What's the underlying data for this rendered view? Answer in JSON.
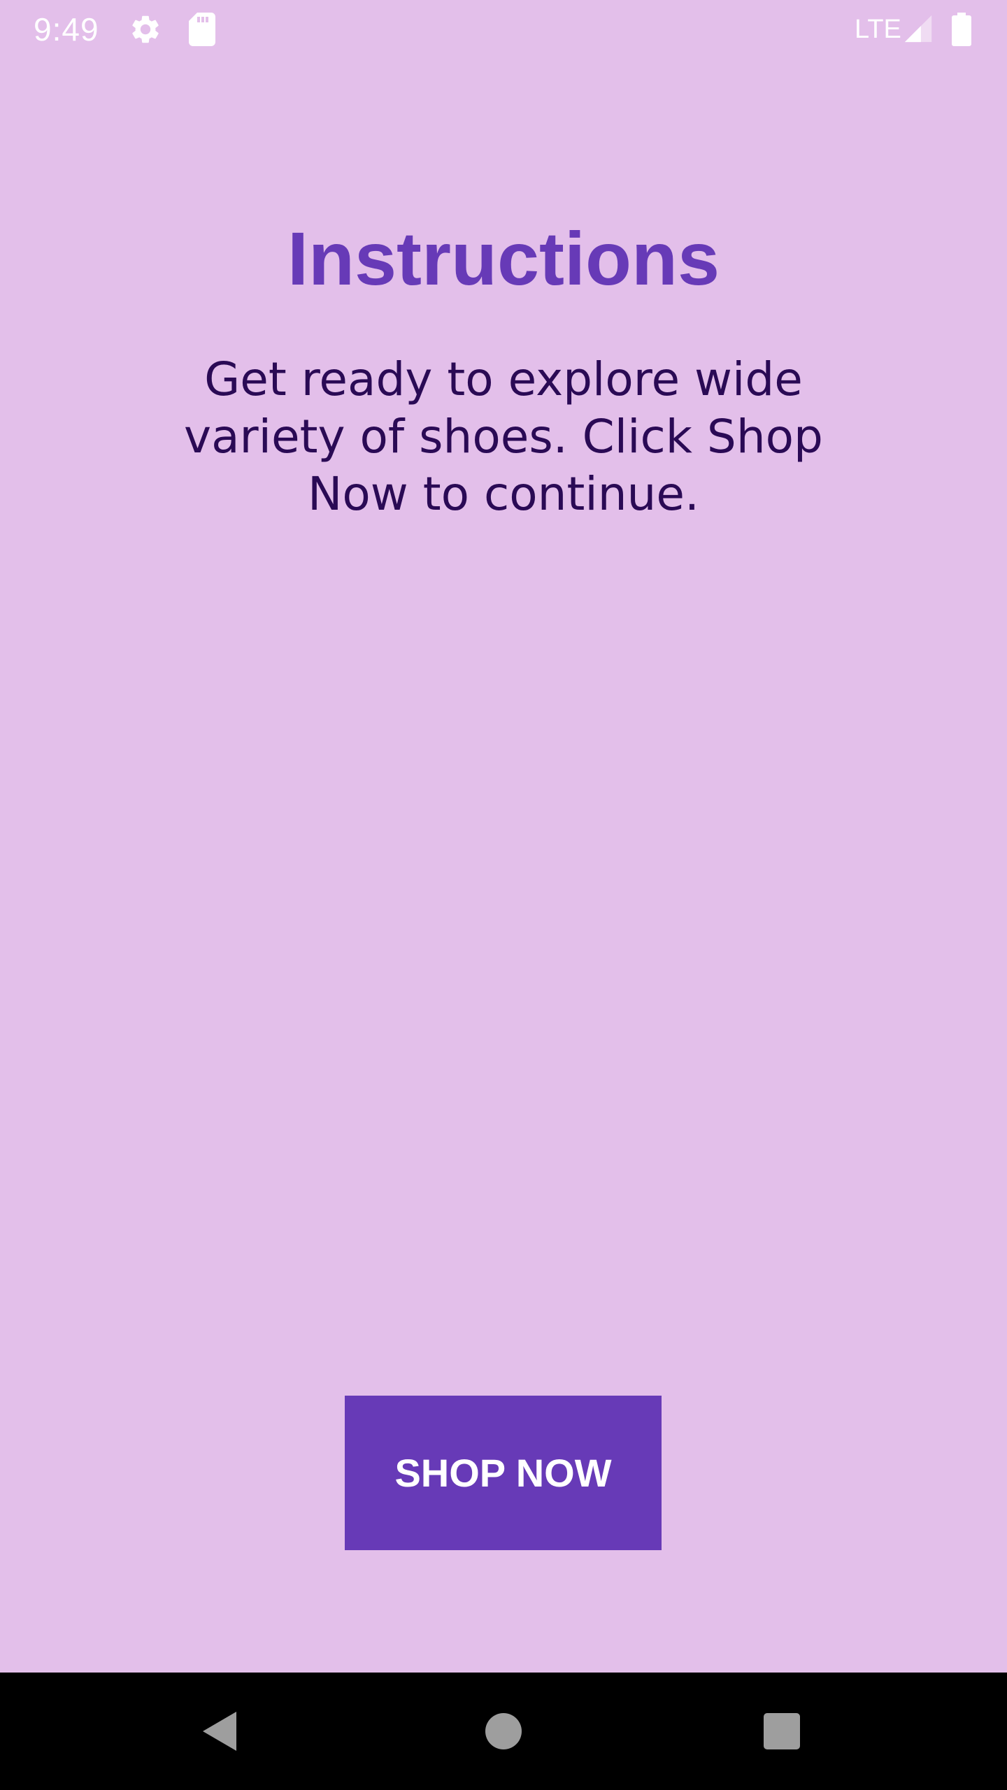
{
  "status_bar": {
    "time": "9:49",
    "network": "LTE",
    "icons": [
      "gear-icon",
      "sd-card-icon",
      "signal-icon",
      "battery-icon"
    ]
  },
  "main": {
    "title": "Instructions",
    "description": "Get ready to explore wide variety of shoes. Click Shop Now to continue.",
    "shop_button_label": "SHOP NOW"
  },
  "nav_bar": {
    "icons": [
      "back-icon",
      "home-icon",
      "recents-icon"
    ]
  },
  "colors": {
    "background": "#e3bfea",
    "accent": "#673ab7",
    "body_text": "#2a0a55",
    "nav_bar": "#000000"
  }
}
